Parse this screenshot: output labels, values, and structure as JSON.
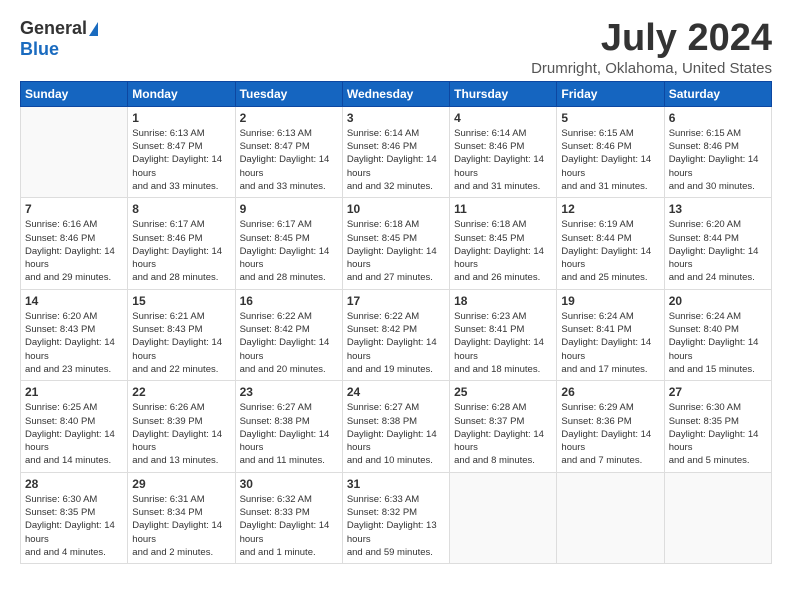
{
  "logo": {
    "general": "General",
    "blue": "Blue"
  },
  "title": "July 2024",
  "location": "Drumright, Oklahoma, United States",
  "days_header": [
    "Sunday",
    "Monday",
    "Tuesday",
    "Wednesday",
    "Thursday",
    "Friday",
    "Saturday"
  ],
  "weeks": [
    [
      {
        "day": "",
        "sunrise": "",
        "sunset": "",
        "daylight": ""
      },
      {
        "day": "1",
        "sunrise": "Sunrise: 6:13 AM",
        "sunset": "Sunset: 8:47 PM",
        "daylight": "Daylight: 14 hours and 33 minutes."
      },
      {
        "day": "2",
        "sunrise": "Sunrise: 6:13 AM",
        "sunset": "Sunset: 8:47 PM",
        "daylight": "Daylight: 14 hours and 33 minutes."
      },
      {
        "day": "3",
        "sunrise": "Sunrise: 6:14 AM",
        "sunset": "Sunset: 8:46 PM",
        "daylight": "Daylight: 14 hours and 32 minutes."
      },
      {
        "day": "4",
        "sunrise": "Sunrise: 6:14 AM",
        "sunset": "Sunset: 8:46 PM",
        "daylight": "Daylight: 14 hours and 31 minutes."
      },
      {
        "day": "5",
        "sunrise": "Sunrise: 6:15 AM",
        "sunset": "Sunset: 8:46 PM",
        "daylight": "Daylight: 14 hours and 31 minutes."
      },
      {
        "day": "6",
        "sunrise": "Sunrise: 6:15 AM",
        "sunset": "Sunset: 8:46 PM",
        "daylight": "Daylight: 14 hours and 30 minutes."
      }
    ],
    [
      {
        "day": "7",
        "sunrise": "Sunrise: 6:16 AM",
        "sunset": "Sunset: 8:46 PM",
        "daylight": "Daylight: 14 hours and 29 minutes."
      },
      {
        "day": "8",
        "sunrise": "Sunrise: 6:17 AM",
        "sunset": "Sunset: 8:46 PM",
        "daylight": "Daylight: 14 hours and 28 minutes."
      },
      {
        "day": "9",
        "sunrise": "Sunrise: 6:17 AM",
        "sunset": "Sunset: 8:45 PM",
        "daylight": "Daylight: 14 hours and 28 minutes."
      },
      {
        "day": "10",
        "sunrise": "Sunrise: 6:18 AM",
        "sunset": "Sunset: 8:45 PM",
        "daylight": "Daylight: 14 hours and 27 minutes."
      },
      {
        "day": "11",
        "sunrise": "Sunrise: 6:18 AM",
        "sunset": "Sunset: 8:45 PM",
        "daylight": "Daylight: 14 hours and 26 minutes."
      },
      {
        "day": "12",
        "sunrise": "Sunrise: 6:19 AM",
        "sunset": "Sunset: 8:44 PM",
        "daylight": "Daylight: 14 hours and 25 minutes."
      },
      {
        "day": "13",
        "sunrise": "Sunrise: 6:20 AM",
        "sunset": "Sunset: 8:44 PM",
        "daylight": "Daylight: 14 hours and 24 minutes."
      }
    ],
    [
      {
        "day": "14",
        "sunrise": "Sunrise: 6:20 AM",
        "sunset": "Sunset: 8:43 PM",
        "daylight": "Daylight: 14 hours and 23 minutes."
      },
      {
        "day": "15",
        "sunrise": "Sunrise: 6:21 AM",
        "sunset": "Sunset: 8:43 PM",
        "daylight": "Daylight: 14 hours and 22 minutes."
      },
      {
        "day": "16",
        "sunrise": "Sunrise: 6:22 AM",
        "sunset": "Sunset: 8:42 PM",
        "daylight": "Daylight: 14 hours and 20 minutes."
      },
      {
        "day": "17",
        "sunrise": "Sunrise: 6:22 AM",
        "sunset": "Sunset: 8:42 PM",
        "daylight": "Daylight: 14 hours and 19 minutes."
      },
      {
        "day": "18",
        "sunrise": "Sunrise: 6:23 AM",
        "sunset": "Sunset: 8:41 PM",
        "daylight": "Daylight: 14 hours and 18 minutes."
      },
      {
        "day": "19",
        "sunrise": "Sunrise: 6:24 AM",
        "sunset": "Sunset: 8:41 PM",
        "daylight": "Daylight: 14 hours and 17 minutes."
      },
      {
        "day": "20",
        "sunrise": "Sunrise: 6:24 AM",
        "sunset": "Sunset: 8:40 PM",
        "daylight": "Daylight: 14 hours and 15 minutes."
      }
    ],
    [
      {
        "day": "21",
        "sunrise": "Sunrise: 6:25 AM",
        "sunset": "Sunset: 8:40 PM",
        "daylight": "Daylight: 14 hours and 14 minutes."
      },
      {
        "day": "22",
        "sunrise": "Sunrise: 6:26 AM",
        "sunset": "Sunset: 8:39 PM",
        "daylight": "Daylight: 14 hours and 13 minutes."
      },
      {
        "day": "23",
        "sunrise": "Sunrise: 6:27 AM",
        "sunset": "Sunset: 8:38 PM",
        "daylight": "Daylight: 14 hours and 11 minutes."
      },
      {
        "day": "24",
        "sunrise": "Sunrise: 6:27 AM",
        "sunset": "Sunset: 8:38 PM",
        "daylight": "Daylight: 14 hours and 10 minutes."
      },
      {
        "day": "25",
        "sunrise": "Sunrise: 6:28 AM",
        "sunset": "Sunset: 8:37 PM",
        "daylight": "Daylight: 14 hours and 8 minutes."
      },
      {
        "day": "26",
        "sunrise": "Sunrise: 6:29 AM",
        "sunset": "Sunset: 8:36 PM",
        "daylight": "Daylight: 14 hours and 7 minutes."
      },
      {
        "day": "27",
        "sunrise": "Sunrise: 6:30 AM",
        "sunset": "Sunset: 8:35 PM",
        "daylight": "Daylight: 14 hours and 5 minutes."
      }
    ],
    [
      {
        "day": "28",
        "sunrise": "Sunrise: 6:30 AM",
        "sunset": "Sunset: 8:35 PM",
        "daylight": "Daylight: 14 hours and 4 minutes."
      },
      {
        "day": "29",
        "sunrise": "Sunrise: 6:31 AM",
        "sunset": "Sunset: 8:34 PM",
        "daylight": "Daylight: 14 hours and 2 minutes."
      },
      {
        "day": "30",
        "sunrise": "Sunrise: 6:32 AM",
        "sunset": "Sunset: 8:33 PM",
        "daylight": "Daylight: 14 hours and 1 minute."
      },
      {
        "day": "31",
        "sunrise": "Sunrise: 6:33 AM",
        "sunset": "Sunset: 8:32 PM",
        "daylight": "Daylight: 13 hours and 59 minutes."
      },
      {
        "day": "",
        "sunrise": "",
        "sunset": "",
        "daylight": ""
      },
      {
        "day": "",
        "sunrise": "",
        "sunset": "",
        "daylight": ""
      },
      {
        "day": "",
        "sunrise": "",
        "sunset": "",
        "daylight": ""
      }
    ]
  ]
}
